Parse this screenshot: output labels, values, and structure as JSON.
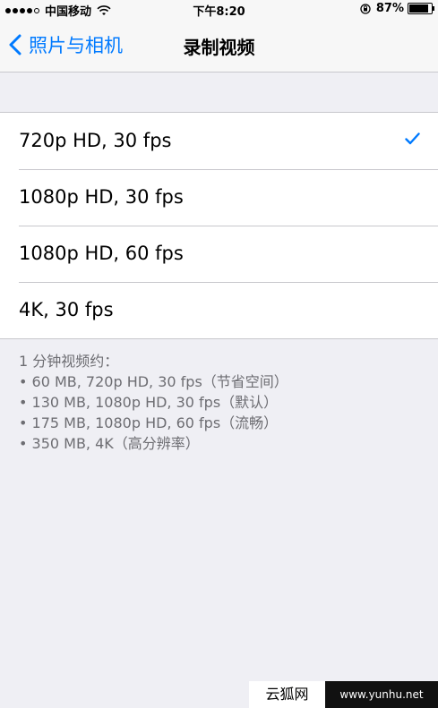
{
  "status_bar": {
    "carrier": "中国移动",
    "time": "下午8:20",
    "battery_percent_text": "87%",
    "battery_level": 0.87
  },
  "nav": {
    "back_label": "照片与相机",
    "title": "录制视频"
  },
  "options": [
    {
      "label": "720p HD, 30 fps",
      "selected": true
    },
    {
      "label": "1080p HD, 30 fps",
      "selected": false
    },
    {
      "label": "1080p HD, 60 fps",
      "selected": false
    },
    {
      "label": "4K, 30 fps",
      "selected": false
    }
  ],
  "footer": {
    "intro": "1 分钟视频约：",
    "lines": [
      "• 60 MB, 720p HD, 30 fps（节省空间）",
      "• 130 MB, 1080p HD, 30 fps（默认）",
      "• 175 MB, 1080p HD, 60 fps（流畅）",
      "• 350 MB, 4K（高分辨率）"
    ]
  },
  "watermark": {
    "site_name": "云狐网",
    "url": "www.yunhu.net"
  },
  "colors": {
    "accent": "#007aff",
    "background": "#efeff4"
  }
}
